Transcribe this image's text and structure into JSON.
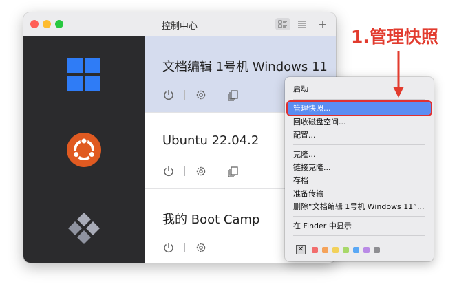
{
  "window": {
    "title": "控制中心"
  },
  "toolbar": {
    "add_label": "+"
  },
  "vms": [
    {
      "name": "文档编辑 1号机 Windows 11",
      "os": "windows",
      "selected": true,
      "actions": [
        "power",
        "settings",
        "snapshots"
      ]
    },
    {
      "name": "Ubuntu 22.04.2",
      "os": "ubuntu",
      "selected": false,
      "actions": [
        "power",
        "settings",
        "snapshots"
      ]
    },
    {
      "name": "我的 Boot Camp",
      "os": "bootcamp",
      "selected": false,
      "actions": [
        "power",
        "settings"
      ]
    }
  ],
  "context_menu": {
    "items": [
      {
        "label": "启动"
      },
      {
        "label": "管理快照...",
        "highlighted": true
      },
      {
        "label": "回收磁盘空间..."
      },
      {
        "label": "配置..."
      },
      {
        "label": "克隆..."
      },
      {
        "label": "链接克隆..."
      },
      {
        "label": "存档"
      },
      {
        "label": "准备传输"
      },
      {
        "label": "删除“文档编辑 1号机 Windows 11”..."
      },
      {
        "label": "在 Finder 中显示"
      }
    ],
    "tag_none": "✕",
    "tag_colors": [
      "#f26d6d",
      "#f5a35a",
      "#f2d15a",
      "#a8d86a",
      "#5aa8f5",
      "#b98ae6",
      "#8e8e92"
    ]
  },
  "annotation": {
    "text": "1.管理快照",
    "color": "#e23b2e"
  }
}
